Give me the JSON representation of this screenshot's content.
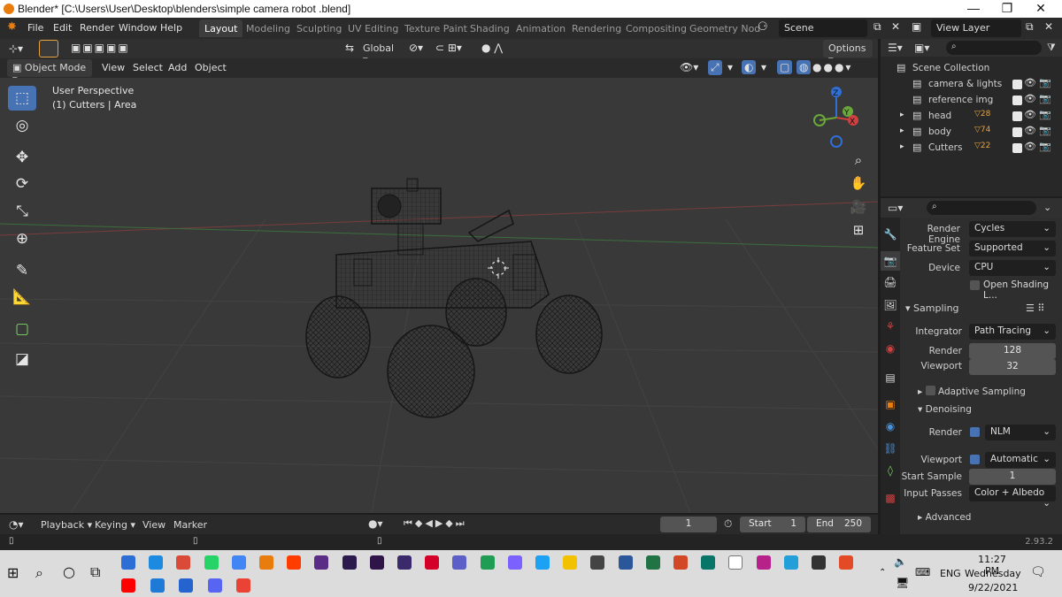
{
  "window": {
    "title": "Blender* [C:\\Users\\User\\Desktop\\blenders\\simple camera robot .blend]",
    "controls": [
      "—",
      "❐",
      "✕"
    ]
  },
  "menubar": {
    "items": [
      "File",
      "Edit",
      "Render",
      "Window",
      "Help"
    ],
    "workspaces": [
      "Layout",
      "Modeling",
      "Sculpting",
      "UV Editing",
      "Texture Paint",
      "Shading",
      "Animation",
      "Rendering",
      "Compositing",
      "Geometry Nod"
    ],
    "active_workspace": "Layout",
    "scene": "Scene",
    "view_layer": "View Layer"
  },
  "viewport_header": {
    "transform_orientation": "Global",
    "options_label": "Options",
    "mode": "Object Mode",
    "menus": [
      "View",
      "Select",
      "Add",
      "Object"
    ]
  },
  "viewport": {
    "perspective_label": "User Perspective",
    "object_info": "(1) Cutters | Area",
    "gizmo_axes": {
      "z": "Z",
      "x": "X",
      "y": "Y"
    },
    "tools": [
      "select-box-icon",
      "cursor-icon",
      "move-icon",
      "rotate-icon",
      "scale-icon",
      "transform-icon",
      "annotate-icon",
      "measure-icon",
      "add-cube-icon",
      "shader-icon"
    ]
  },
  "outliner": {
    "root": "Scene Collection",
    "items": [
      {
        "label": "camera & lights",
        "expandable": false
      },
      {
        "label": "reference img",
        "expandable": false
      },
      {
        "label": "head",
        "expandable": true,
        "badge": "28"
      },
      {
        "label": "body",
        "expandable": true,
        "badge": "74"
      },
      {
        "label": "Cutters",
        "expandable": true,
        "badge": "22"
      }
    ]
  },
  "properties": {
    "render_engine_label": "Render Engine",
    "render_engine": "Cycles",
    "feature_set_label": "Feature Set",
    "feature_set": "Supported",
    "device_label": "Device",
    "device": "CPU",
    "open_shading": "Open Shading L...",
    "sampling_title": "Sampling",
    "integrator_label": "Integrator",
    "integrator": "Path Tracing",
    "render_label": "Render",
    "render_samples": "128",
    "viewport_label": "Viewport",
    "viewport_samples": "32",
    "adaptive_sampling": "Adaptive Sampling",
    "denoising_title": "Denoising",
    "denoise_render_label": "Render",
    "denoise_render": "NLM",
    "denoise_viewport_label": "Viewport",
    "denoise_viewport": "Automatic",
    "start_sample_label": "Start Sample",
    "start_sample": "1",
    "input_passes_label": "Input Passes",
    "input_passes": "Color + Albedo",
    "advanced": "Advanced"
  },
  "timeline": {
    "menus": [
      "Playback",
      "Keying",
      "View",
      "Marker"
    ],
    "current_frame": "1",
    "start_label": "Start",
    "start": "1",
    "end_label": "End",
    "end": "250"
  },
  "status": {
    "version": "2.93.2"
  },
  "taskbar": {
    "time": "11:27 PM",
    "day": "Wednesday",
    "date": "9/22/2021",
    "language": "ENG",
    "icon_colors": [
      "#2b6fd6",
      "#1b8ae0",
      "#d94a38",
      "#25d366",
      "#4285f4",
      "#e87d0d",
      "#ff3d00",
      "#5b2c86",
      "#2d1a4d",
      "#2f1447",
      "#3b2a6b",
      "#d4002a",
      "#5b5fc7",
      "#1f9d55",
      "#7b61ff",
      "#1da1f2",
      "#f2c200",
      "#444444",
      "#2b579a",
      "#217346",
      "#d24726",
      "#077568",
      "#ffffff",
      "#b7228a",
      "#229ed9",
      "#333333",
      "#e44a25"
    ],
    "row2_colors": [
      "#ff0000",
      "#1e7ad6",
      "#2564cf",
      "#5865f2",
      "#ea4335"
    ]
  }
}
